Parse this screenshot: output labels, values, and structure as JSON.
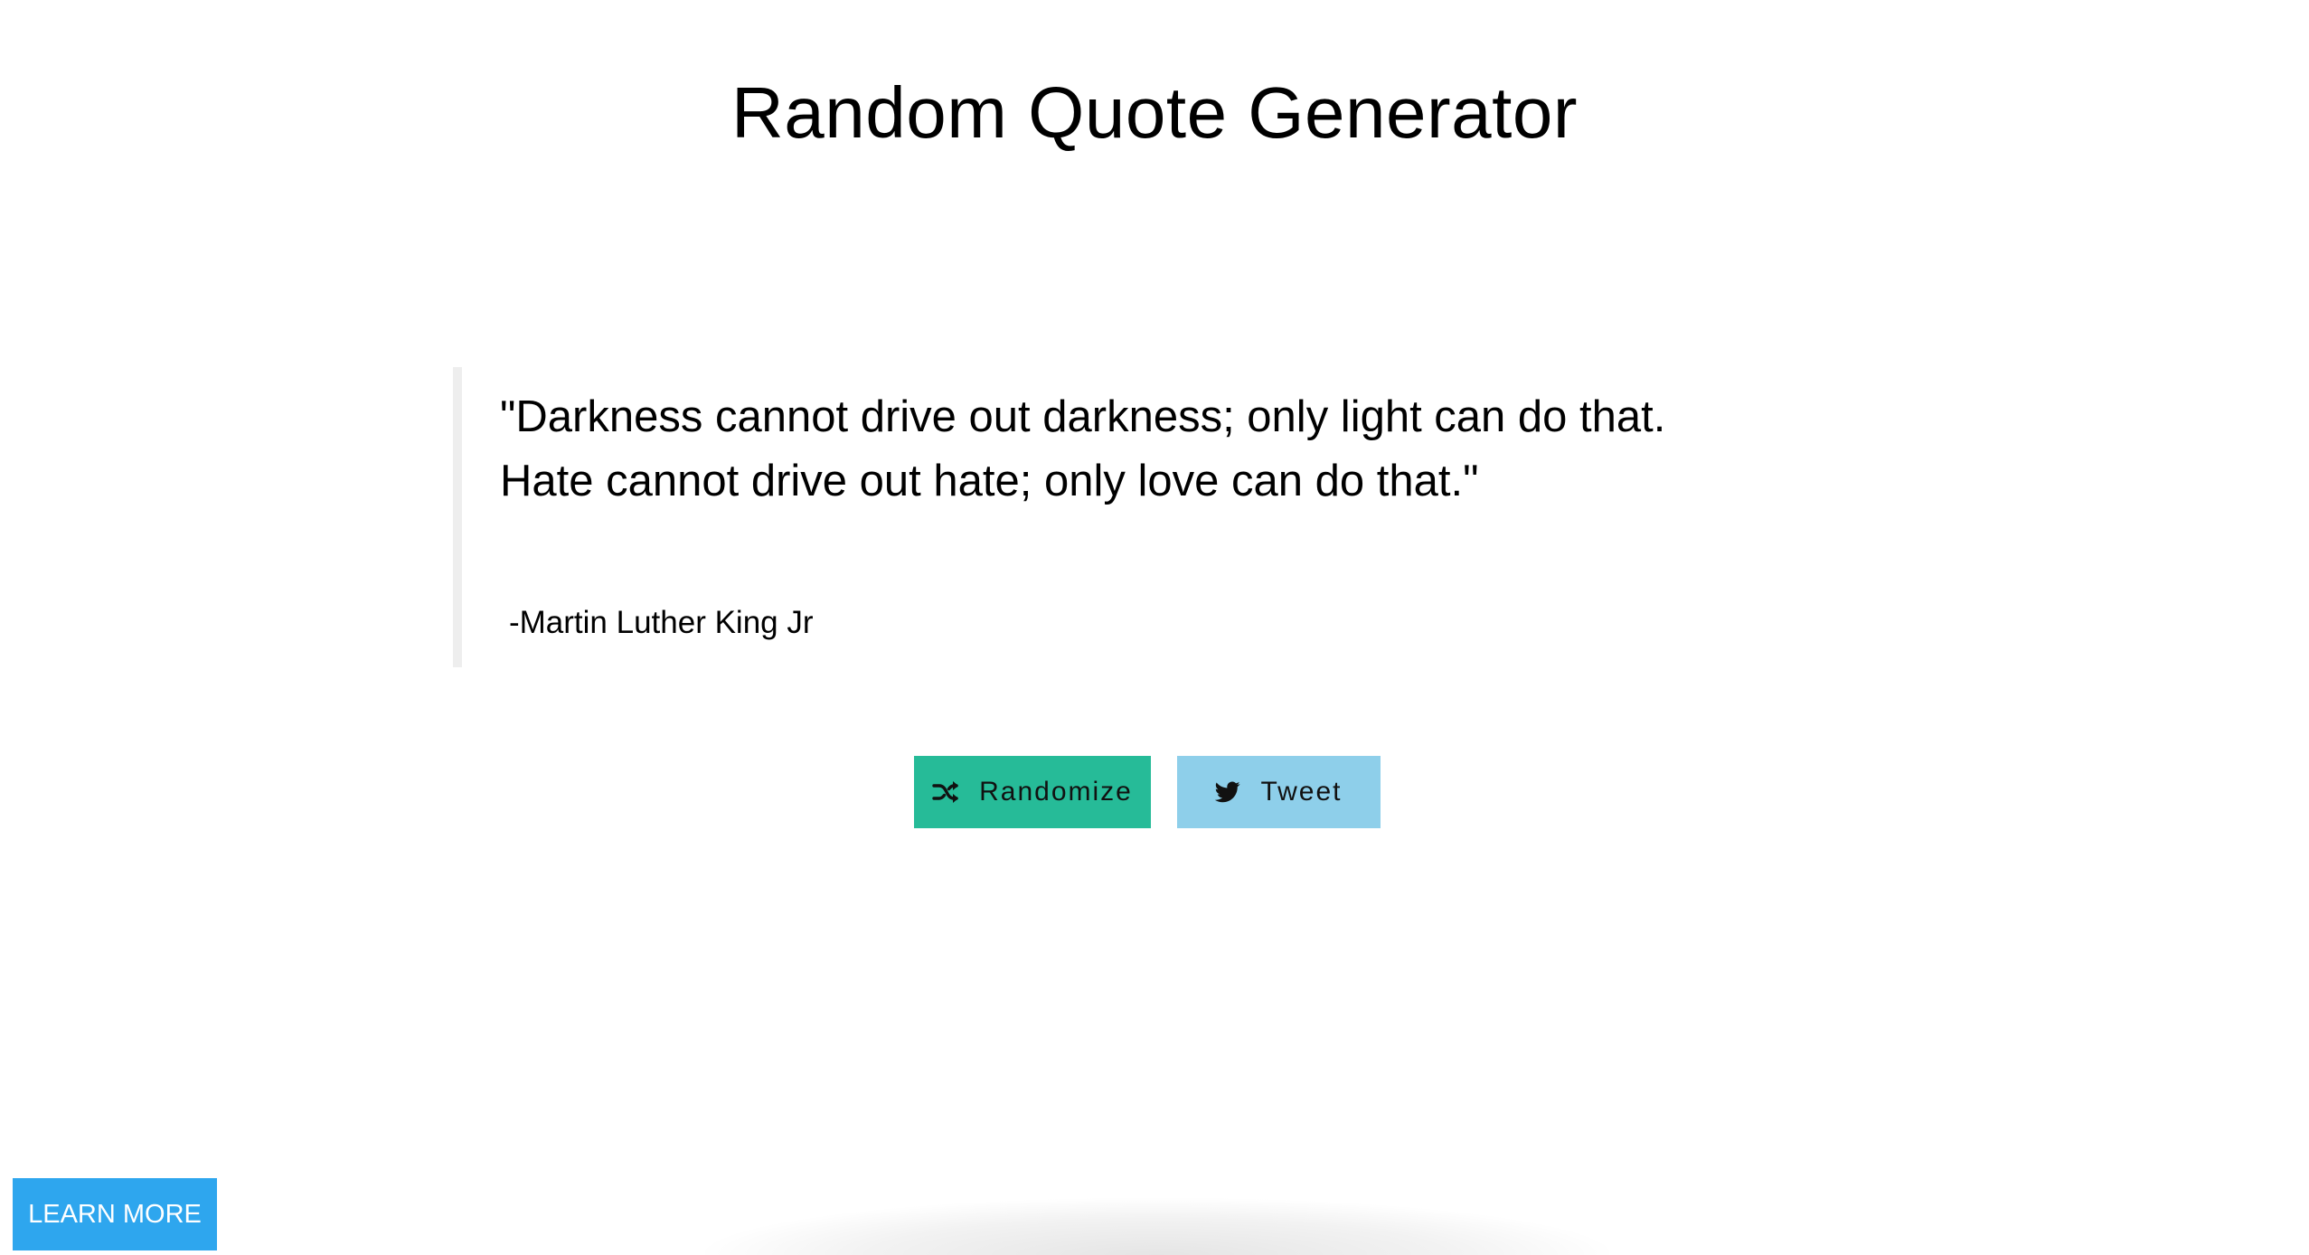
{
  "header": {
    "title": "Random Quote Generator"
  },
  "quote": {
    "line1": "\"Darkness cannot drive out darkness; only light can do that.",
    "line2": "Hate cannot drive out hate; only love can do that.\"",
    "author": "-Martin Luther King Jr"
  },
  "actions": {
    "randomize_label": "Randomize",
    "randomize_icon": "shuffle-icon",
    "tweet_label": "Tweet",
    "tweet_icon": "twitter-icon"
  },
  "footer": {
    "learn_more_label": "LEARN MORE"
  },
  "colors": {
    "randomize_button": "#26bb98",
    "tweet_button": "#8ecfea",
    "learn_more_button": "#2ea6ee",
    "quote_border": "#eeeeee"
  }
}
